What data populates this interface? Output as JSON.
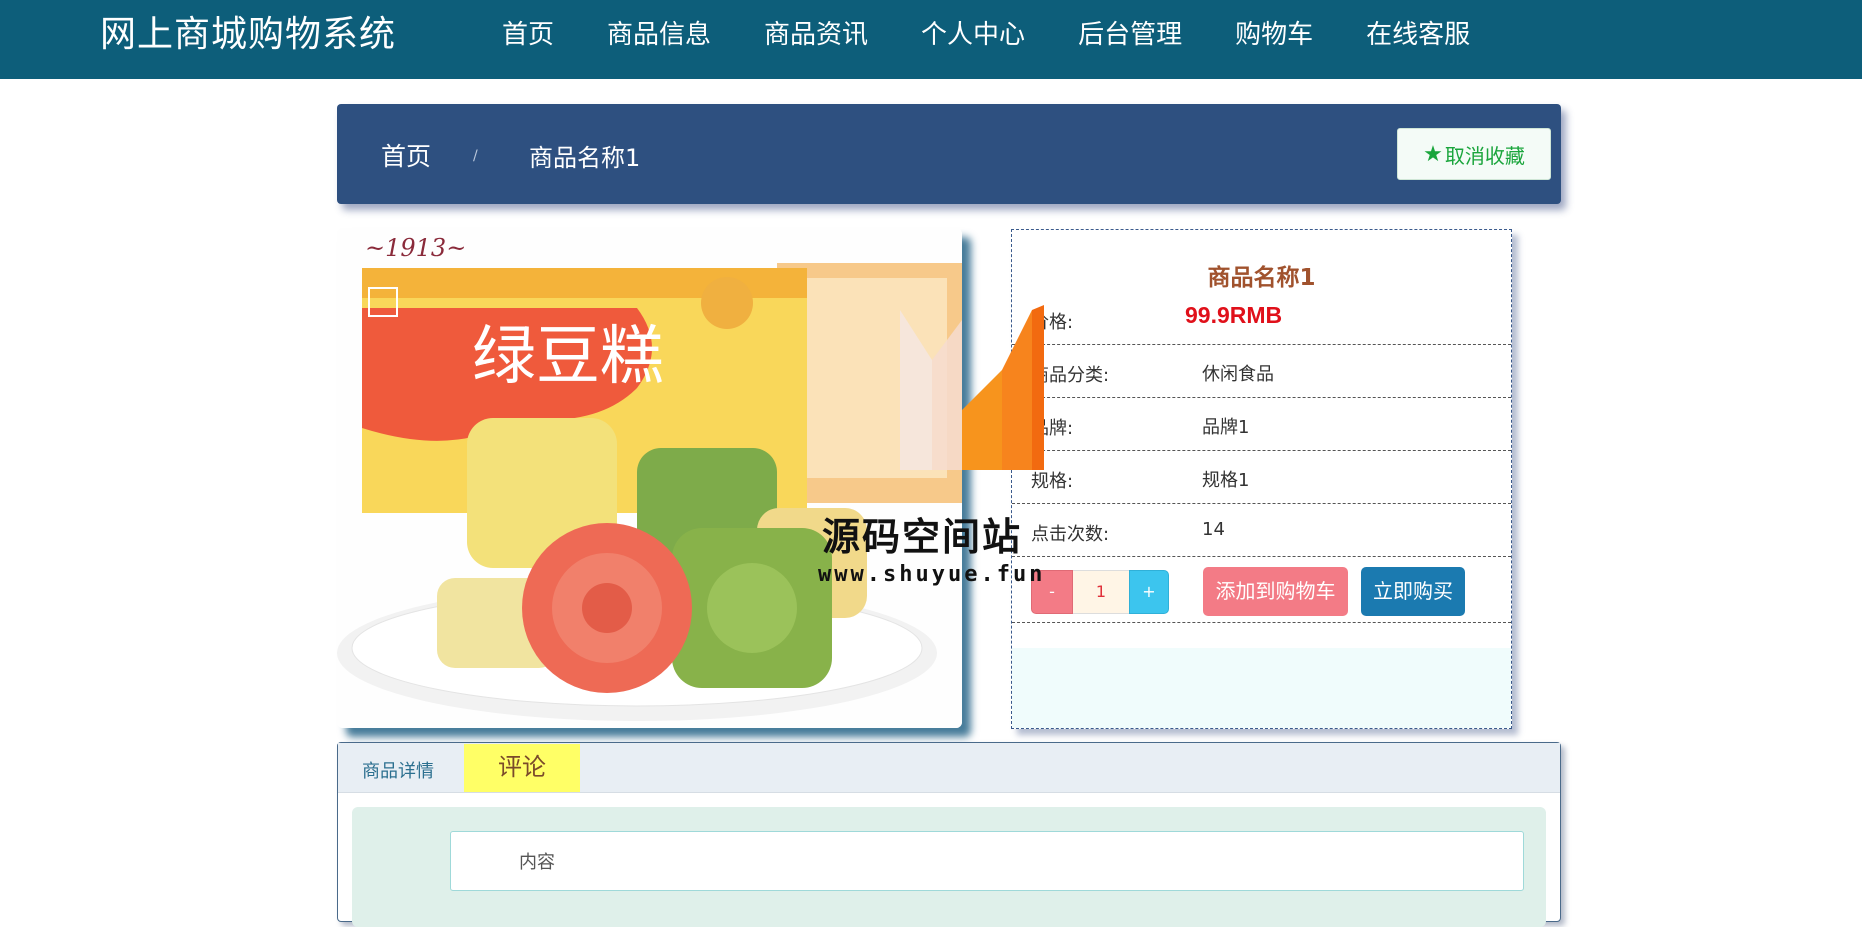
{
  "header": {
    "brand": "网上商城购物系统",
    "nav": [
      "首页",
      "商品信息",
      "商品资讯",
      "个人中心",
      "后台管理",
      "购物车",
      "在线客服"
    ],
    "active_index": 0
  },
  "breadcrumb": {
    "home": "首页",
    "separator": "/",
    "current": "商品名称1",
    "favorite_button": "取消收藏"
  },
  "product": {
    "title": "商品名称1",
    "price_label": "价格:",
    "price": "99.9RMB",
    "rows": [
      {
        "label": "商品分类:",
        "value": "休闲食品"
      },
      {
        "label": "品牌:",
        "value": "品牌1"
      },
      {
        "label": "规格:",
        "value": "规格1"
      },
      {
        "label": "点击次数:",
        "value": "14"
      }
    ],
    "quantity": {
      "minus": "-",
      "value": "1",
      "plus": "+"
    },
    "add_to_cart": "添加到购物车",
    "buy_now": "立即购买",
    "image_text": {
      "year": "~1913~",
      "name": "绿豆糕"
    }
  },
  "watermark": {
    "text": "源码空间站",
    "url": "www.shuyue.fun"
  },
  "tabs": {
    "detail": "商品详情",
    "review": "评论",
    "comment_placeholder": "内容"
  },
  "colors": {
    "topbar": "#0d5e7a",
    "breadcrumb_bg": "#2e5080",
    "price": "#e0101a",
    "add_cart": "#f37b86",
    "buy_now": "#1b7ab0",
    "review_tab": "#ffff66"
  }
}
